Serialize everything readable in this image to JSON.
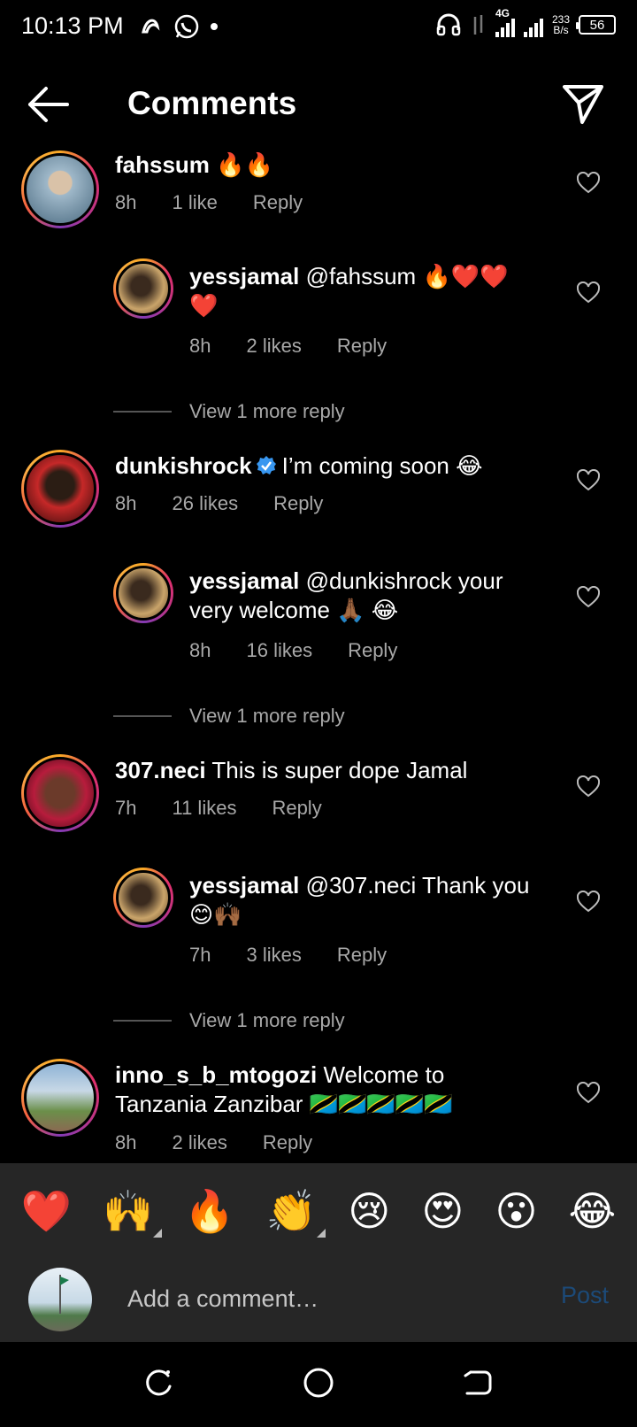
{
  "status_bar": {
    "time": "10:13 PM",
    "net_speed_value": "233",
    "net_speed_unit": "B/s",
    "network_type": "4G",
    "battery": "56",
    "icons": [
      "snapchat-icon",
      "whatsapp-icon",
      "headphones-icon",
      "data-arrows-icon",
      "signal-icon"
    ]
  },
  "header": {
    "title": "Comments",
    "back_icon": "arrow-left-icon",
    "share_icon": "paper-plane-icon"
  },
  "comments": [
    {
      "user": "fahssum",
      "text": "🔥🔥",
      "time": "8h",
      "likes": "1 like",
      "reply_label": "Reply",
      "avatar_colors": [
        "#9fb8c9",
        "#4a6a80"
      ],
      "replies": [
        {
          "user": "yessjamal",
          "text": "@fahssum 🔥❤️❤️❤️",
          "time": "8h",
          "likes": "2 likes",
          "reply_label": "Reply",
          "avatar_colors": [
            "#c9a46a",
            "#5a3b1e"
          ]
        }
      ],
      "view_more": "View 1 more reply"
    },
    {
      "user": "dunkishrock",
      "verified": true,
      "text": "I’m coming soon 😂",
      "time": "8h",
      "likes": "26 likes",
      "reply_label": "Reply",
      "avatar_colors": [
        "#c62828",
        "#2b0a0a"
      ],
      "replies": [
        {
          "user": "yessjamal",
          "text": "@dunkishrock your very welcome 🙏🏾 😂",
          "time": "8h",
          "likes": "16 likes",
          "reply_label": "Reply",
          "avatar_colors": [
            "#c9a46a",
            "#5a3b1e"
          ]
        }
      ],
      "view_more": "View 1 more reply"
    },
    {
      "user": "307.neci",
      "text": "This is super dope Jamal",
      "time": "7h",
      "likes": "11 likes",
      "reply_label": "Reply",
      "avatar_colors": [
        "#b71c3c",
        "#3a0a14"
      ],
      "replies": [
        {
          "user": "yessjamal",
          "text": "@307.neci Thank you 😊🙌🏾",
          "time": "7h",
          "likes": "3 likes",
          "reply_label": "Reply",
          "avatar_colors": [
            "#c9a46a",
            "#5a3b1e"
          ]
        }
      ],
      "view_more": "View 1 more reply"
    },
    {
      "user": "inno_s_b_mtogozi",
      "text": "Welcome to Tanzania Zanzibar 🇹🇿🇹🇿🇹🇿🇹🇿🇹🇿",
      "time": "8h",
      "likes": "2 likes",
      "reply_label": "Reply",
      "avatar_colors": [
        "#8fb4d6",
        "#6b8f4a"
      ]
    }
  ],
  "emoji_bar": [
    "❤️",
    "🙌",
    "🔥",
    "👏",
    "😢",
    "😍",
    "😮",
    "😂"
  ],
  "add_comment": {
    "placeholder": "Add a comment…",
    "post_label": "Post"
  },
  "nav_bar": [
    "recents-icon",
    "home-icon",
    "back-icon"
  ]
}
